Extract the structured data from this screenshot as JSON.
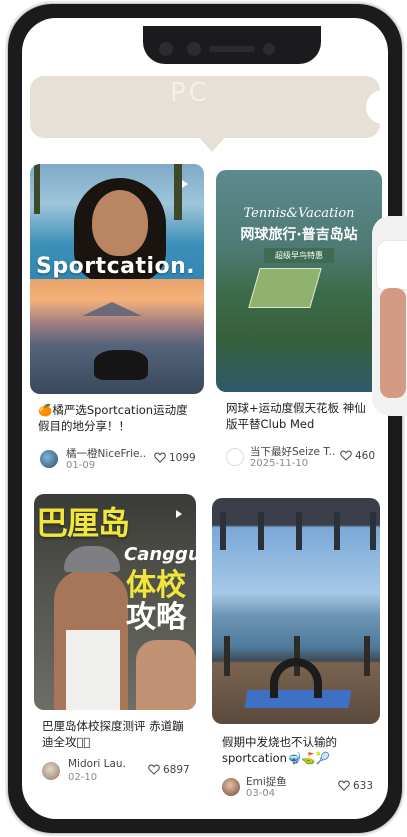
{
  "banner": {
    "watermark": "PC",
    "accent": "#e6e0d7"
  },
  "cards": [
    {
      "image_text": "Sportcation.",
      "title": "🍊橘严选Sportcation运动度假目的地分享！！",
      "author": "橘一橙NiceFrie..",
      "date": "01-09",
      "likes": "1099"
    },
    {
      "image_title_en": "Tennis&Vacation",
      "image_title_cn": "网球旅行·普吉岛站",
      "image_sub": "超级早鸟特惠",
      "title": "网球+运动度假天花板 神仙版平替Club Med",
      "author": "当下最好Seize T...",
      "date": "2025-11-10",
      "likes": "460"
    },
    {
      "image_title": "巴厘岛",
      "image_canggu": "Canggu",
      "image_line2": "体校",
      "image_line3": "攻略",
      "title": "巴厘岛体校探度测评 赤道蹦迪全攻略🏻",
      "author": "Midori Lau.",
      "date": "02-10",
      "likes": "6897"
    },
    {
      "title": "假期中发烧也不认输的sportcation🤿⛳🎾",
      "author": "Emi捉鱼",
      "date": "03-04",
      "likes": "633"
    }
  ]
}
